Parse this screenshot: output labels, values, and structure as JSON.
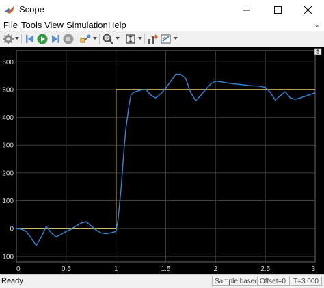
{
  "window": {
    "title": "Scope",
    "icons": {
      "app": "matlab-scope-icon",
      "minimize": "minimize-icon",
      "maximize": "maximize-icon",
      "close": "close-icon"
    }
  },
  "menu": {
    "items": [
      {
        "label": "File",
        "mnemonic": "F"
      },
      {
        "label": "Tools",
        "mnemonic": "T"
      },
      {
        "label": "View",
        "mnemonic": "V"
      },
      {
        "label": "Simulation",
        "mnemonic": "S"
      },
      {
        "label": "Help",
        "mnemonic": "H"
      }
    ],
    "overflow_icon": "chevron-down-icon"
  },
  "toolbar": {
    "buttons": [
      "settings-gear-icon",
      "step-back-icon",
      "run-icon",
      "step-forward-icon",
      "stop-icon",
      "highlight-block-icon",
      "zoom-in-icon",
      "autoscale-icon",
      "cursor-measure-icon",
      "style-icon"
    ]
  },
  "status": {
    "left": "Ready",
    "mode": "Sample based",
    "offset": "Offset=0",
    "time": "T=3.000"
  },
  "colors": {
    "plot_background": "#000000",
    "grid": "#3c3c3c",
    "signal": "#2f8ad8",
    "reference": "#e8d26a",
    "tick_text": "#d8d8d8"
  },
  "chart_data": {
    "type": "line",
    "title": "",
    "xlabel": "",
    "ylabel": "",
    "xlim": [
      0,
      3
    ],
    "ylim": [
      -120,
      640
    ],
    "grid": true,
    "x_ticks": [
      0,
      0.5,
      1,
      1.5,
      2,
      2.5,
      3
    ],
    "x_tick_labels": [
      "0",
      "0.5",
      "1",
      "1.5",
      "2",
      "2.5",
      "3"
    ],
    "y_ticks": [
      -100,
      0,
      100,
      200,
      300,
      400,
      500,
      600
    ],
    "y_tick_labels": [
      "-100",
      "0",
      "100",
      "200",
      "300",
      "400",
      "500",
      "600"
    ],
    "series": [
      {
        "color": "#e8d26a",
        "x": [
          0,
          1.0,
          1.0,
          3.0
        ],
        "y": [
          0,
          0,
          500,
          500
        ]
      },
      {
        "color": "#2f8ad8",
        "x": [
          0,
          0.05,
          0.1,
          0.15,
          0.2,
          0.25,
          0.3,
          0.35,
          0.4,
          0.45,
          0.5,
          0.55,
          0.6,
          0.65,
          0.7,
          0.75,
          0.8,
          0.85,
          0.9,
          0.95,
          1.0,
          1.02,
          1.05,
          1.08,
          1.1,
          1.13,
          1.15,
          1.18,
          1.2,
          1.25,
          1.3,
          1.35,
          1.4,
          1.45,
          1.5,
          1.55,
          1.6,
          1.65,
          1.7,
          1.75,
          1.8,
          1.85,
          1.9,
          1.95,
          2.0,
          2.05,
          2.1,
          2.15,
          2.2,
          2.25,
          2.3,
          2.35,
          2.4,
          2.45,
          2.5,
          2.55,
          2.6,
          2.65,
          2.7,
          2.75,
          2.8,
          2.85,
          2.9,
          2.95,
          3.0
        ],
        "y": [
          0,
          -2,
          -10,
          -35,
          -60,
          -30,
          8,
          -15,
          -30,
          -20,
          -10,
          -2,
          10,
          20,
          25,
          10,
          -5,
          -15,
          -18,
          -15,
          -10,
          30,
          140,
          280,
          360,
          440,
          480,
          490,
          493,
          498,
          500,
          480,
          470,
          485,
          505,
          530,
          555,
          555,
          540,
          490,
          460,
          478,
          500,
          520,
          530,
          528,
          525,
          522,
          520,
          518,
          516,
          514,
          513,
          512,
          508,
          490,
          462,
          478,
          492,
          470,
          465,
          470,
          476,
          482,
          488
        ]
      }
    ]
  }
}
